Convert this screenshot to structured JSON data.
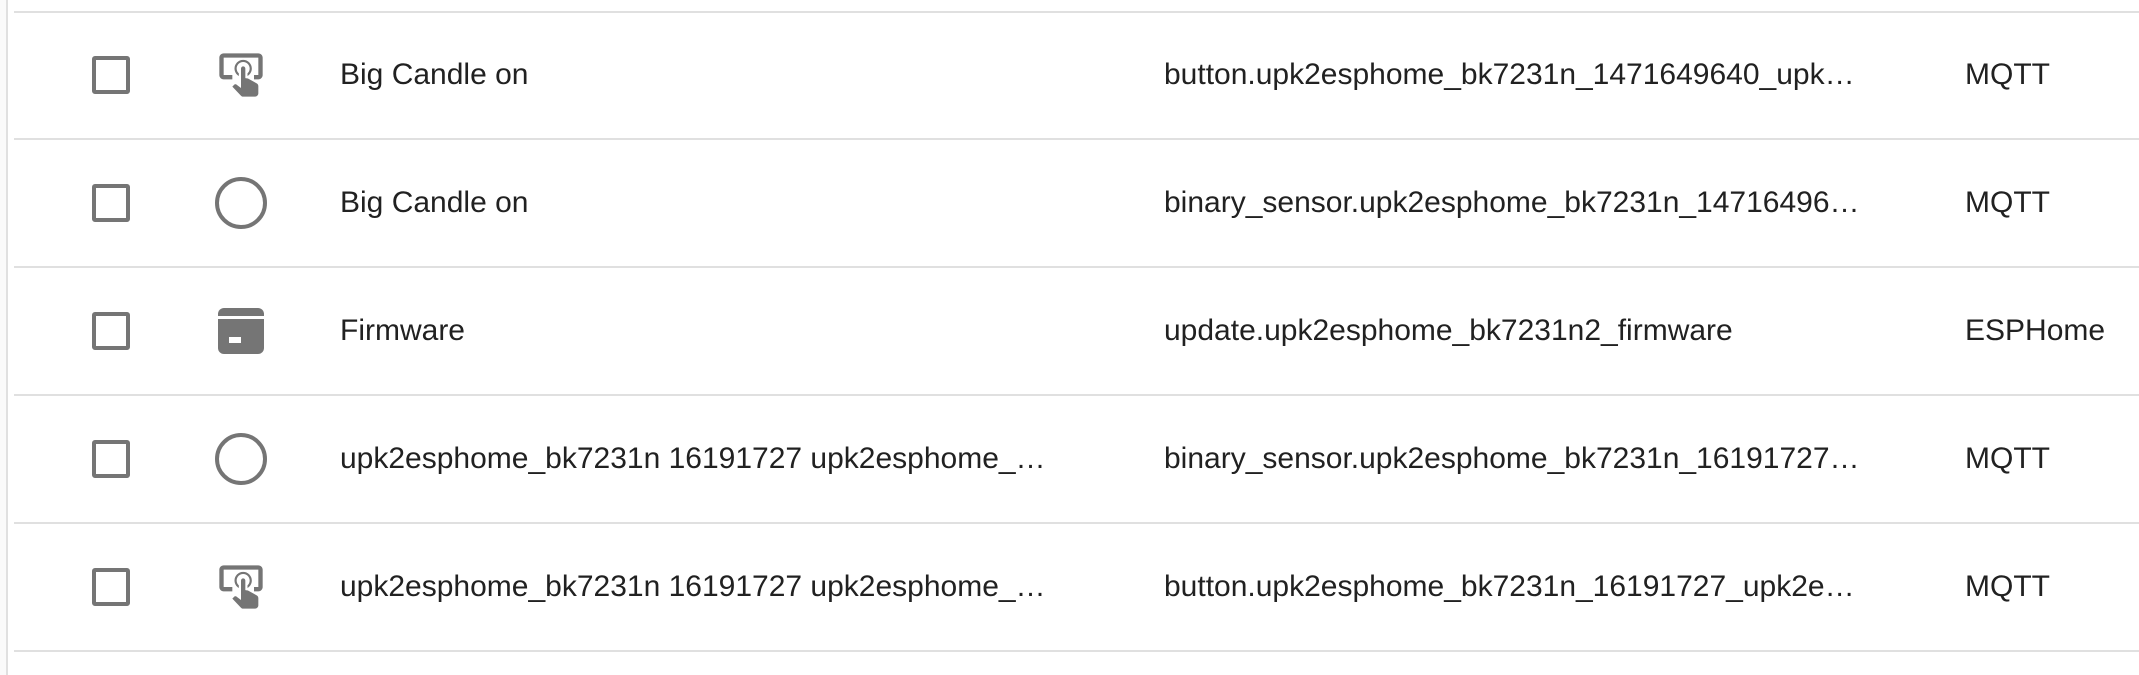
{
  "colors": {
    "icon": "#757575",
    "checkbox_border": "#757575",
    "divider": "#e0e0e0",
    "text": "#212121"
  },
  "rows": [
    {
      "icon": "gesture-tap-button-icon",
      "name": "Big Candle on",
      "entity_id": "button.upk2esphome_bk7231n_1471649640_upk…",
      "integration": "MQTT"
    },
    {
      "icon": "circle-outline-icon",
      "name": "Big Candle on",
      "entity_id": "binary_sensor.upk2esphome_bk7231n_14716496…",
      "integration": "MQTT"
    },
    {
      "icon": "package-up-icon",
      "name": "Firmware",
      "entity_id": "update.upk2esphome_bk7231n2_firmware",
      "integration": "ESPHome"
    },
    {
      "icon": "circle-outline-icon",
      "name": "upk2esphome_bk7231n 16191727 upk2esphome_…",
      "entity_id": "binary_sensor.upk2esphome_bk7231n_16191727…",
      "integration": "MQTT"
    },
    {
      "icon": "gesture-tap-button-icon",
      "name": "upk2esphome_bk7231n 16191727 upk2esphome_…",
      "entity_id": "button.upk2esphome_bk7231n_16191727_upk2e…",
      "integration": "MQTT"
    }
  ]
}
